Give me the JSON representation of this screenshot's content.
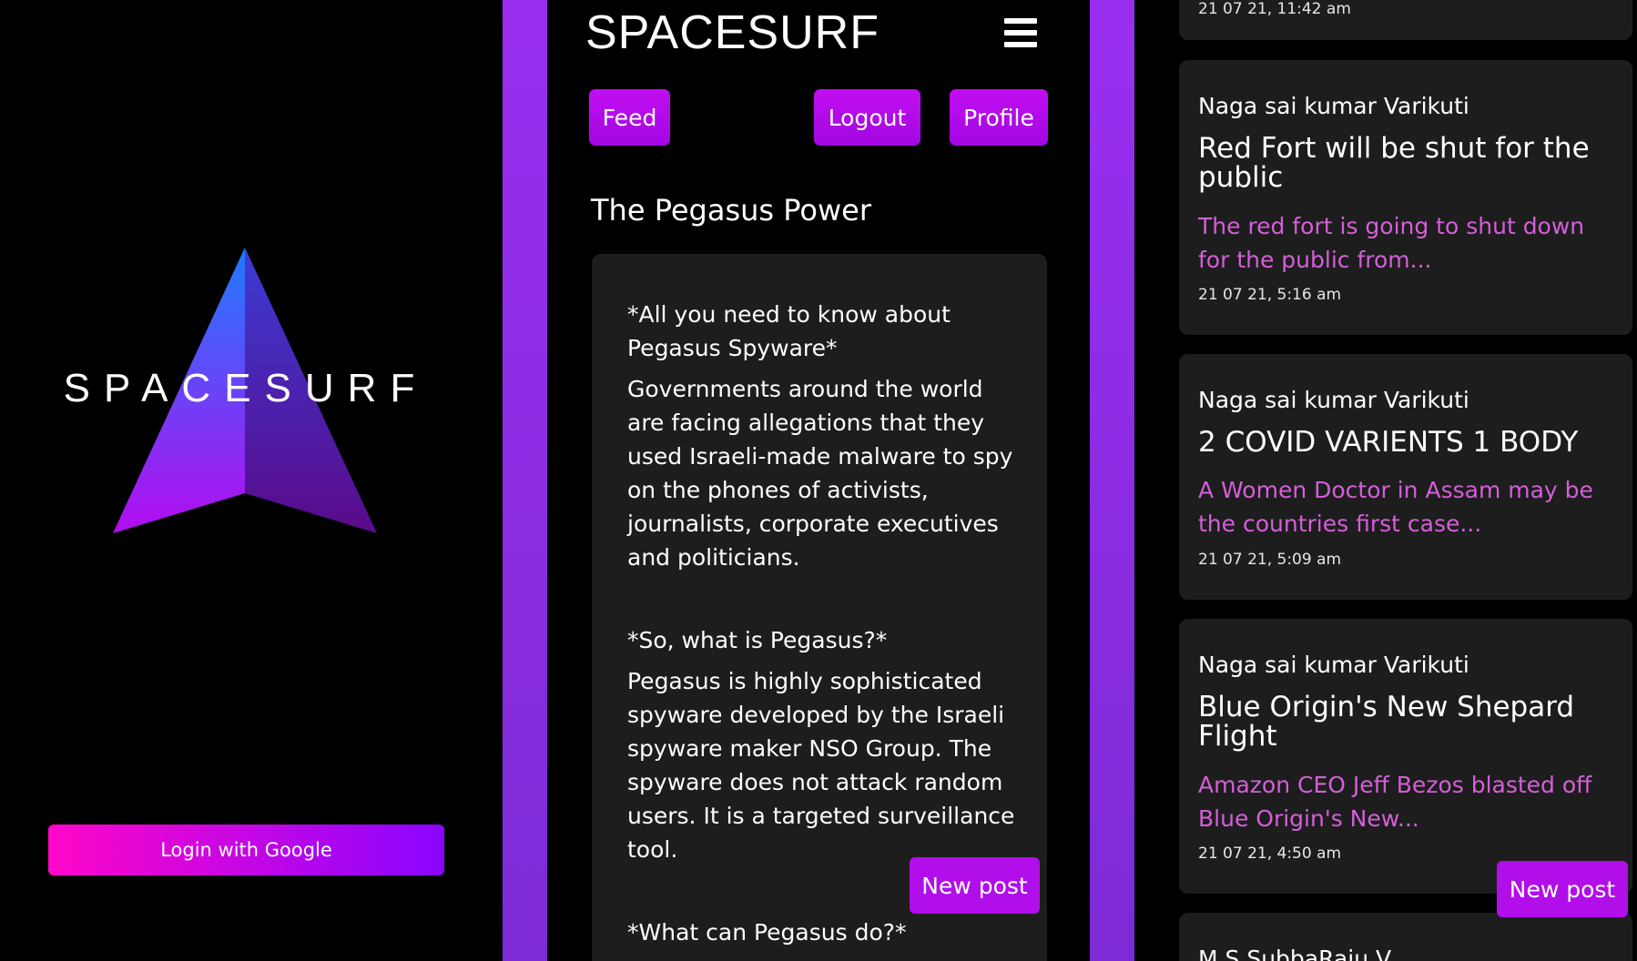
{
  "splash": {
    "title": "SPACESURF",
    "login_label": "Login with Google"
  },
  "header": {
    "brand": "SPACESURF"
  },
  "nav": {
    "feed": "Feed",
    "logout": "Logout",
    "profile": "Profile"
  },
  "post": {
    "title": "The Pegasus Power",
    "paragraphs": [
      "*All you need to know about Pegasus Spyware*",
      "Governments around the world are facing  allegations that they used Israeli-made malware to spy on the phones of activists, journalists, corporate executives and politicians.",
      "*So, what is Pegasus?*",
      "Pegasus is highly sophisticated spyware developed by the Israeli spyware maker NSO Group. The spyware does not attack random users. It is a targeted surveillance tool.",
      "*What can Pegasus do?*"
    ]
  },
  "new_post_label": "New post",
  "feed": {
    "partial_top_date": "21 07 21, 11:42 am",
    "cards": [
      {
        "author": "Naga sai kumar Varikuti",
        "title": "Red Fort will be shut for the public",
        "excerpt": "The red fort is going to shut down for the public from...",
        "date": "21 07 21, 5:16 am"
      },
      {
        "author": "Naga sai kumar Varikuti",
        "title": "2 COVID VARIENTS 1 BODY",
        "excerpt": "A Women Doctor in Assam may be the countries first case...",
        "date": "21 07 21, 5:09 am"
      },
      {
        "author": "Naga sai kumar Varikuti",
        "title": "Blue Origin's New Shepard Flight",
        "excerpt": "Amazon CEO Jeff Bezos blasted off Blue Origin's New...",
        "date": "21 07 21, 4:50 am"
      }
    ],
    "partial_bottom_author": "M S SubbaRaju V"
  },
  "colors": {
    "accent": "#b10eea",
    "excerpt": "#d45fd9",
    "card": "#1d1d1d"
  }
}
